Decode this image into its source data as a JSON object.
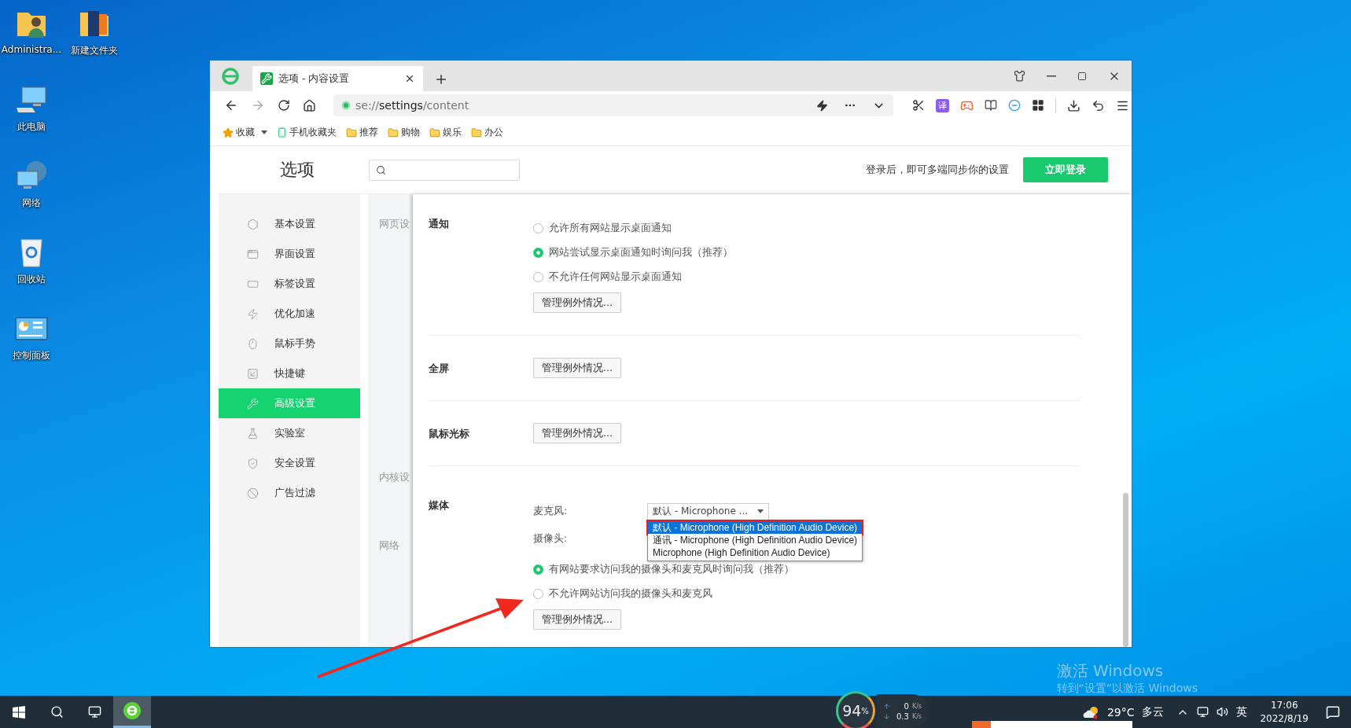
{
  "desktop": {
    "icons": [
      {
        "label": "Administra..."
      },
      {
        "label": "新建文件夹"
      },
      {
        "label": "此电脑"
      },
      {
        "label": "网络"
      },
      {
        "label": "回收站"
      },
      {
        "label": "控制面板"
      }
    ],
    "watermark": {
      "title": "激活 Windows",
      "subtitle": "转到“设置”以激活 Windows"
    }
  },
  "browser": {
    "tabs": [
      {
        "title": "选项 - 内容设置",
        "selected": true
      }
    ],
    "address": {
      "scheme": "se://",
      "host": "settings",
      "path": "/content"
    },
    "translate_badge": "译",
    "bookmarks": [
      {
        "kind": "favorites",
        "label": "收藏"
      },
      {
        "kind": "mobile",
        "label": "手机收藏夹"
      },
      {
        "kind": "folder",
        "label": "推荐"
      },
      {
        "kind": "folder",
        "label": "购物"
      },
      {
        "kind": "folder",
        "label": "娱乐"
      },
      {
        "kind": "folder",
        "label": "办公"
      }
    ]
  },
  "page": {
    "title": "选项",
    "sync_text": "登录后，即可多端同步你的设置",
    "login_button": "立即登录",
    "sidebar": [
      {
        "label": "基本设置",
        "selected": false
      },
      {
        "label": "界面设置",
        "selected": false
      },
      {
        "label": "标签设置",
        "selected": false
      },
      {
        "label": "优化加速",
        "selected": false
      },
      {
        "label": "鼠标手势",
        "selected": false
      },
      {
        "label": "快捷键",
        "selected": false
      },
      {
        "label": "高级设置",
        "selected": true
      },
      {
        "label": "实验室",
        "selected": false
      },
      {
        "label": "安全设置",
        "selected": false
      },
      {
        "label": "广告过滤",
        "selected": false
      }
    ],
    "subnav": [
      "网页设",
      "内核设",
      "网络"
    ],
    "sections": [
      {
        "kind": "radios",
        "title": "通知",
        "options": [
          {
            "label": "允许所有网站显示桌面通知",
            "selected": false
          },
          {
            "label": "网站尝试显示桌面通知时询问我（推荐）",
            "selected": true
          },
          {
            "label": "不允许任何网站显示桌面通知",
            "selected": false
          }
        ],
        "button": "管理例外情况..."
      },
      {
        "kind": "button",
        "title": "全屏",
        "button": "管理例外情况..."
      },
      {
        "kind": "button",
        "title": "鼠标光标",
        "button": "管理例外情况..."
      },
      {
        "kind": "media",
        "title": "媒体",
        "fields": [
          {
            "label": "麦克风:",
            "value": "默认 - Microphone ...",
            "expanded": true,
            "options": [
              {
                "label": "默认 - Microphone (High Definition Audio Device)",
                "selected": true
              },
              {
                "label": "通讯 - Microphone (High Definition Audio Device)",
                "selected": false
              },
              {
                "label": "Microphone (High Definition Audio Device)",
                "selected": false
              }
            ]
          },
          {
            "label": "摄像头:"
          }
        ],
        "options": [
          {
            "label": "有网站要求访问我的摄像头和麦克风时询问我（推荐）",
            "selected": true
          },
          {
            "label": "不允许网站访问我的摄像头和麦克风",
            "selected": false
          }
        ],
        "button": "管理例外情况..."
      }
    ]
  },
  "taskbar": {
    "apps": [
      {
        "kind": "browser",
        "selected": true
      }
    ],
    "performance": {
      "value": "94",
      "unit": "%"
    },
    "network": {
      "up": {
        "value": "0",
        "unit": "K/s"
      },
      "down": {
        "value": "0.3",
        "unit": "K/s"
      }
    },
    "weather": {
      "temp": "29°C",
      "condition": "多云"
    },
    "ime": "英",
    "time": "17:06",
    "date": "2022/8/19"
  }
}
